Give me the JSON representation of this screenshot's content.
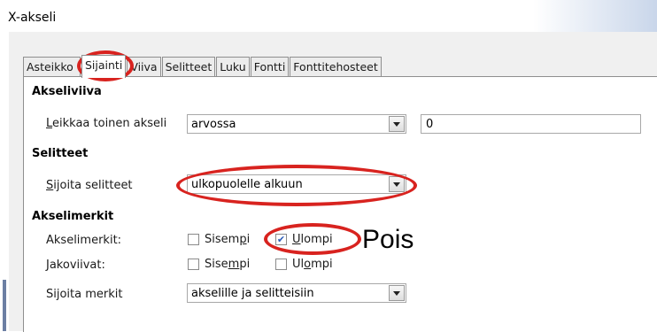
{
  "window": {
    "title": "X-akseli"
  },
  "tabs": [
    {
      "label": "Asteikko",
      "active": false
    },
    {
      "label": "Sijainti",
      "active": true
    },
    {
      "label": "Viiva",
      "active": false
    },
    {
      "label": "Selitteet",
      "active": false
    },
    {
      "label": "Luku",
      "active": false
    },
    {
      "label": "Fontti",
      "active": false
    },
    {
      "label": "Fonttitehosteet",
      "active": false
    }
  ],
  "akseliviiva": {
    "title": "Akseliviiva",
    "cut_label_u": "L",
    "cut_label_rest": "eikkaa toinen akseli",
    "cut_value": "arvossa",
    "cut_number": "0"
  },
  "selitteet": {
    "title": "Selitteet",
    "place_label_u": "S",
    "place_label_rest": "ijoita selitteet",
    "place_value": "ulkopuolelle alkuun"
  },
  "akselimerkit": {
    "title": "Akselimerkit",
    "row1_label": "Akselimerkit:",
    "row1_inner_pre": "Sisem",
    "row1_inner_u": "p",
    "row1_inner_post": "i",
    "row1_inner_checked": false,
    "row1_outer_u": "U",
    "row1_outer_rest": "lompi",
    "row1_outer_checked": true,
    "row2_label": "Jakoviivat:",
    "row2_inner_pre": "Sise",
    "row2_inner_u": "m",
    "row2_inner_post": "pi",
    "row2_inner_checked": false,
    "row2_outer_pre": "Ul",
    "row2_outer_u": "o",
    "row2_outer_post": "mpi",
    "row2_outer_checked": false,
    "place_label": "Sijoita merkit",
    "place_value": "akselille ja selitteisiin"
  },
  "annotation": {
    "text": "Pois",
    "color": "#d8231f"
  }
}
